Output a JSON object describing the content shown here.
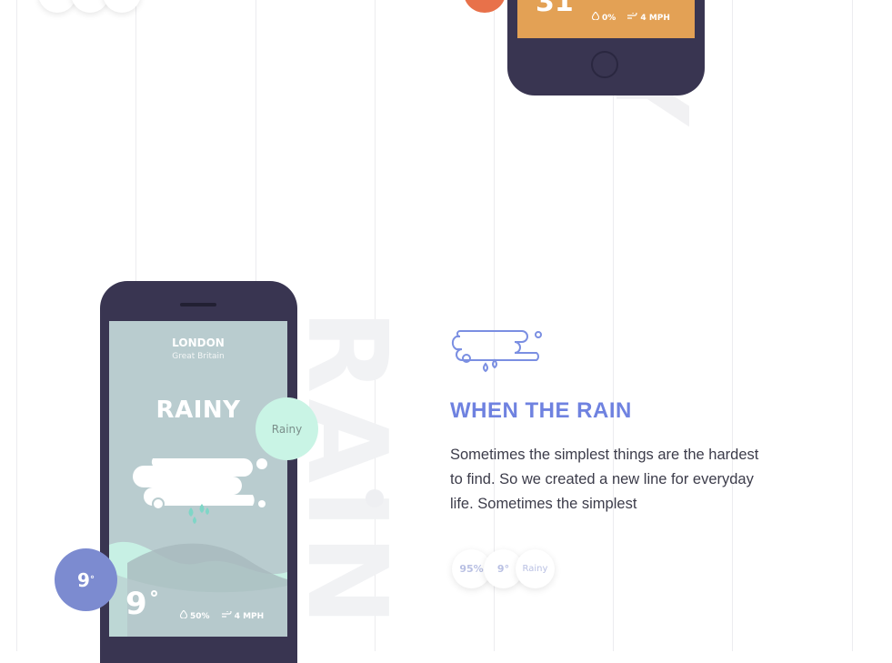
{
  "colors": {
    "accent_blue": "#6f82e0",
    "phone_body": "#393551",
    "rainy_screen": "#b9cccf",
    "sunny_screen": "#e3a155",
    "mint_bubble": "#c9f4e5",
    "temp_bubble": "#7c8bd0",
    "orange_bubble": "#e8714a"
  },
  "top_phone": {
    "temperature": "31",
    "humidity": "0%",
    "wind": "4 MPH"
  },
  "main_phone": {
    "city": "LONDON",
    "country": "Great Britain",
    "condition": "RAINY",
    "temperature": "9",
    "humidity": "50%",
    "wind": "4 MPH",
    "bubble_condition": "Rainy",
    "bubble_temperature": "9",
    "bubble_degree": "°"
  },
  "section": {
    "icon": "rain-cloud-icon",
    "title": "WHEN THE RAIN",
    "description": "Sometimes the simplest things are the hardest to find. So we created a new line for everyday life. Sometimes the simplest",
    "chips": [
      {
        "label": "95%"
      },
      {
        "label": "9°"
      },
      {
        "label": "Rainy"
      }
    ]
  }
}
